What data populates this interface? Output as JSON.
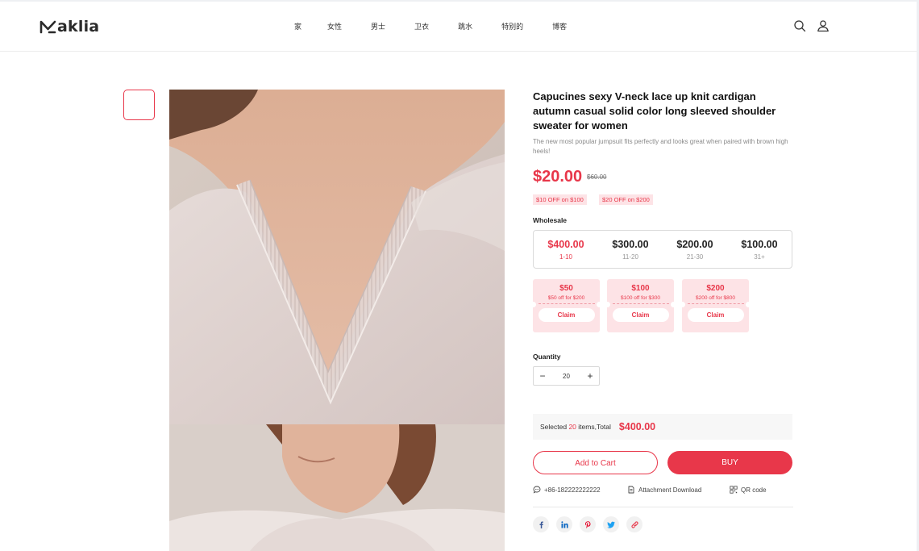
{
  "brand": {
    "name": "aklia"
  },
  "nav": [
    "家",
    "女性",
    "男士",
    "卫衣",
    "跳水",
    "特别的",
    "博客"
  ],
  "product": {
    "title": "Capucines sexy V-neck lace up knit cardigan autumn casual solid color long sleeved shoulder sweater for women",
    "subtitle": "The new most popular jumpsuit fits perfectly and looks great when paired with brown high heels!",
    "price": "$20.00",
    "old_price": "$60.00",
    "tags": [
      "$10 OFF on $100",
      "$20 OFF on $200"
    ]
  },
  "wholesale": {
    "label": "Wholesale",
    "tiers": [
      {
        "price": "$400.00",
        "range": "1-10"
      },
      {
        "price": "$300.00",
        "range": "11-20"
      },
      {
        "price": "$200.00",
        "range": "21-30"
      },
      {
        "price": "$100.00",
        "range": "31+"
      }
    ]
  },
  "coupons": [
    {
      "amount": "$50",
      "condition": "$50 off for $200",
      "button": "Claim"
    },
    {
      "amount": "$100",
      "condition": "$100 off for $300",
      "button": "Claim"
    },
    {
      "amount": "$200",
      "condition": "$200 off for $800",
      "button": "Claim"
    }
  ],
  "quantity": {
    "label": "Quantity",
    "minus": "−",
    "plus": "+",
    "value": "20"
  },
  "summary": {
    "prefix": "Selected ",
    "count": "20",
    "suffix": " items,Total",
    "total": "$400.00"
  },
  "actions": {
    "cart": "Add to Cart",
    "buy": "BUY"
  },
  "meta": {
    "phone": "+86-182222222222",
    "attachment": "Attachment Download",
    "qr": "QR code"
  },
  "colors": {
    "accent": "#e8374a",
    "accent_light": "#fde3e6"
  },
  "share_icons": [
    "facebook-icon",
    "linkedin-icon",
    "pinterest-icon",
    "twitter-icon",
    "link-icon"
  ]
}
